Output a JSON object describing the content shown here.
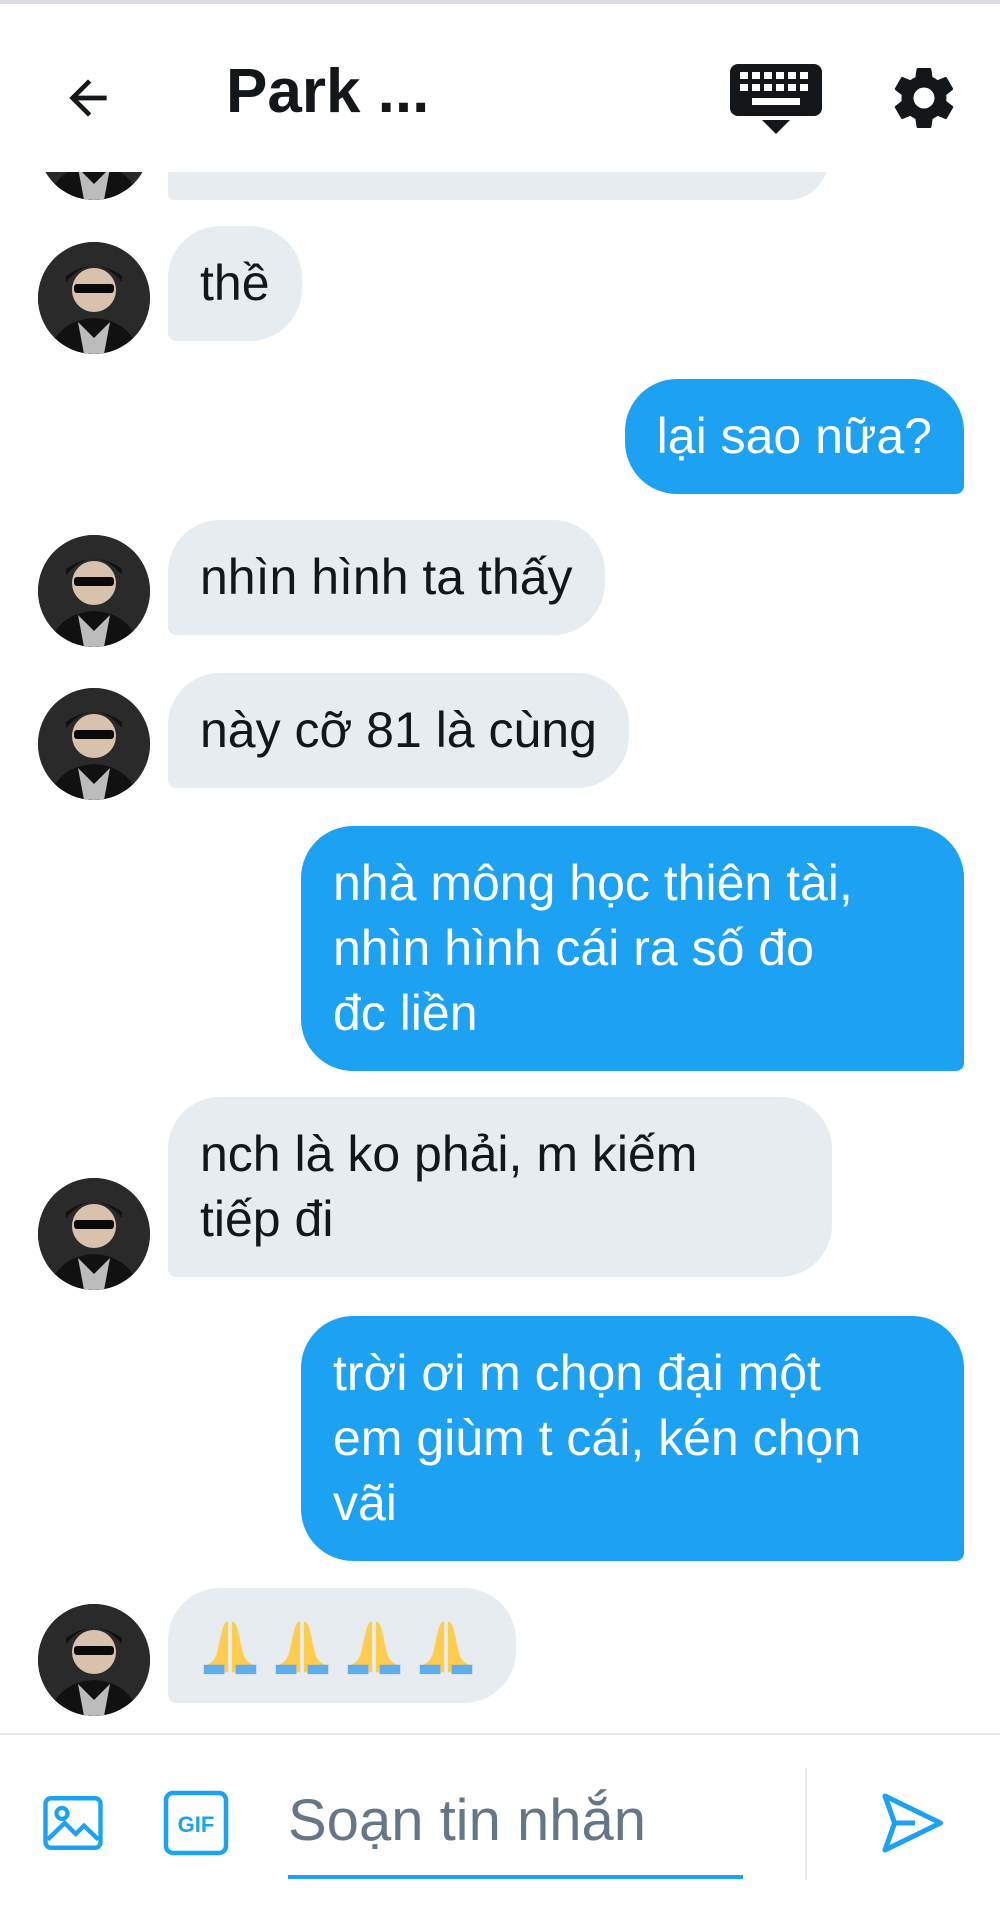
{
  "header": {
    "title": "Park ...",
    "back_icon": "arrow-left-icon",
    "keyboard_icon": "keyboard-icon",
    "settings_icon": "gear-icon"
  },
  "messages": [
    {
      "side": "in",
      "text": "",
      "partial": true
    },
    {
      "side": "in",
      "text": "thề"
    },
    {
      "side": "out",
      "text": "lại sao nữa?"
    },
    {
      "side": "in",
      "text": "nhìn hình ta thấy"
    },
    {
      "side": "in",
      "text": "này cỡ 81 là cùng"
    },
    {
      "side": "out",
      "lines": [
        "nhà mông học thiên tài,",
        "nhìn hình cái ra số đo",
        "đc liền"
      ]
    },
    {
      "side": "in",
      "lines": [
        "nch là ko phải, m kiếm",
        "tiếp đi"
      ]
    },
    {
      "side": "out",
      "lines": [
        "trời ơi m chọn đại một",
        "em giùm t cái, kén chọn",
        "vãi"
      ]
    },
    {
      "side": "in",
      "emoji": [
        "🙏",
        "🙏",
        "🙏",
        "🙏"
      ]
    }
  ],
  "composer": {
    "placeholder": "Soạn tin nhắn",
    "media_icon": "image-icon",
    "gif_label": "GIF",
    "send_icon": "send-icon"
  },
  "colors": {
    "accent": "#1da1f2",
    "incoming_bubble": "#e6ecf0",
    "text_dark": "#14171a",
    "placeholder": "#657786"
  }
}
